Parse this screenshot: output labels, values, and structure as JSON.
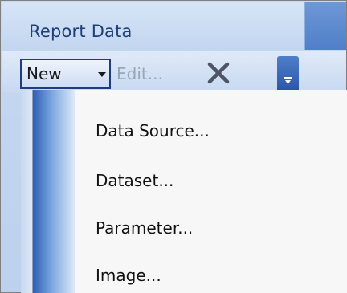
{
  "panel": {
    "title": "Report Data"
  },
  "toolbar": {
    "new_label": "New",
    "edit_label": "Edit...",
    "delete_icon": "close-icon",
    "overflow_icon": "chevron-down-icon"
  },
  "menu": {
    "items": [
      {
        "label": "Data Source..."
      },
      {
        "label": "Dataset..."
      },
      {
        "label": "Parameter..."
      },
      {
        "label": "Image..."
      }
    ]
  },
  "colors": {
    "panel_header": "#c3d6f0",
    "accent": "#2b57a8",
    "menu_background": "#f7f7f7",
    "disabled_text": "#9aa6b8"
  }
}
